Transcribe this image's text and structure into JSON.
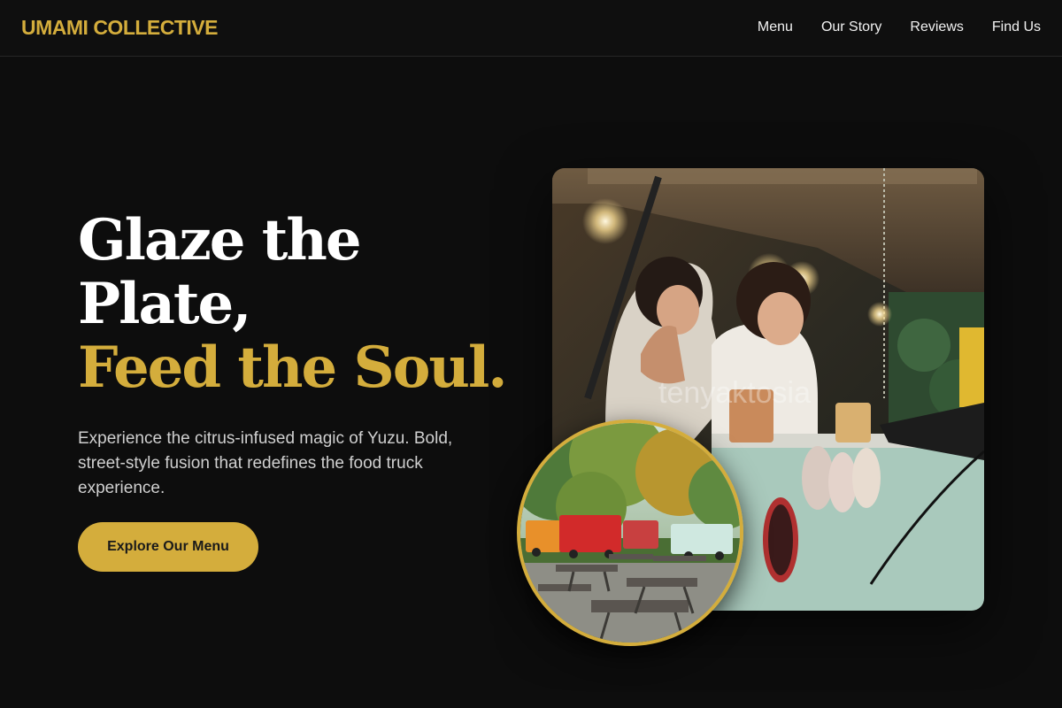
{
  "brand": {
    "name": "UMAMI COLLECTIVE"
  },
  "nav": {
    "items": [
      "Menu",
      "Our Story",
      "Reviews",
      "Find Us"
    ]
  },
  "hero": {
    "headline_line1": "Glaze the",
    "headline_line2": "Plate,",
    "headline_accent": "Feed the Soul.",
    "subtext": "Experience the citrus-infused magic of Yuzu. Bold, street-style fusion that redefines the food truck experience.",
    "cta_label": "Explore Our Menu"
  },
  "images": {
    "main_watermark": "tenyaktosia",
    "main_photo_alt": "Chefs serving food from a food truck window",
    "inset_photo_alt": "Food trucks parked beside picnic tables in a park"
  },
  "colors": {
    "accent": "#d4ad3c",
    "background": "#0d0d0d",
    "text": "#ffffff"
  }
}
